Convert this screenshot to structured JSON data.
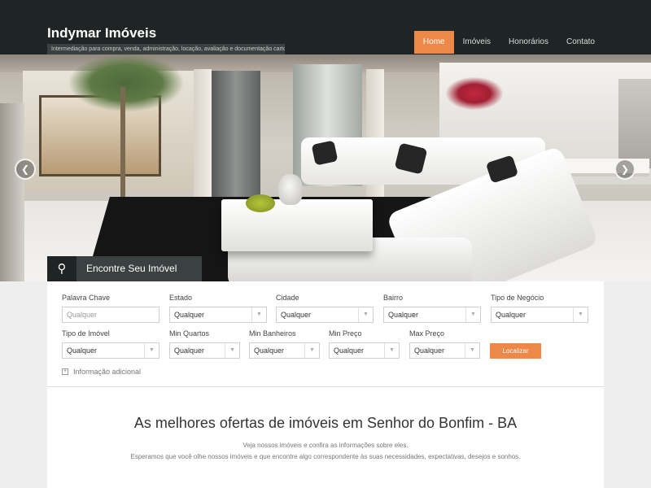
{
  "header": {
    "brand": "Indymar Imóveis",
    "tagline": "Intermediação para compra, venda, administração, locação, avaliação e documentação cartorária",
    "nav": [
      {
        "label": "Home",
        "active": true
      },
      {
        "label": "Imóveis",
        "active": false
      },
      {
        "label": "Honorários",
        "active": false
      },
      {
        "label": "Contato",
        "active": false
      }
    ]
  },
  "hero": {
    "image_alt_subject": "living-room-photo",
    "prev_icon": "chevron-left-icon",
    "next_icon": "chevron-right-icon",
    "find_tab_icon": "search-icon",
    "find_tab_label": "Encontre Seu Imóvel"
  },
  "search": {
    "keyword_label": "Palavra Chave",
    "keyword_placeholder": "Qualquer",
    "estado_label": "Estado",
    "estado_value": "Qualquer",
    "cidade_label": "Cidade",
    "cidade_value": "Qualquer",
    "bairro_label": "Bairro",
    "bairro_value": "Qualquer",
    "negocio_label": "Tipo de Negócio",
    "negocio_value": "Qualquer",
    "tipo_label": "Tipo de Imóvel",
    "tipo_value": "Qualquer",
    "quartos_label": "Min Quartos",
    "quartos_value": "Qualquer",
    "banheiros_label": "Min Banheiros",
    "banheiros_value": "Qualquer",
    "min_preco_label": "Min Preço",
    "min_preco_value": "Qualquer",
    "max_preco_label": "Max Preço",
    "max_preco_value": "Qualquer",
    "submit_label": "Localizar",
    "more_info_label": "Informação adicional"
  },
  "content": {
    "title": "As melhores ofertas de imóveis em Senhor do Bonfim - BA",
    "line1": "Veja nossos imóveis e confira as informações sobre eles.",
    "line2": "Esperamos que você olhe nossos imóveis e que encontre algo correspondente às suas necessidades, expectativas, desejos e sonhos."
  },
  "colors": {
    "header_bg": "#1f2524",
    "accent": "#ee8848",
    "page_bg": "#eeeeee"
  }
}
